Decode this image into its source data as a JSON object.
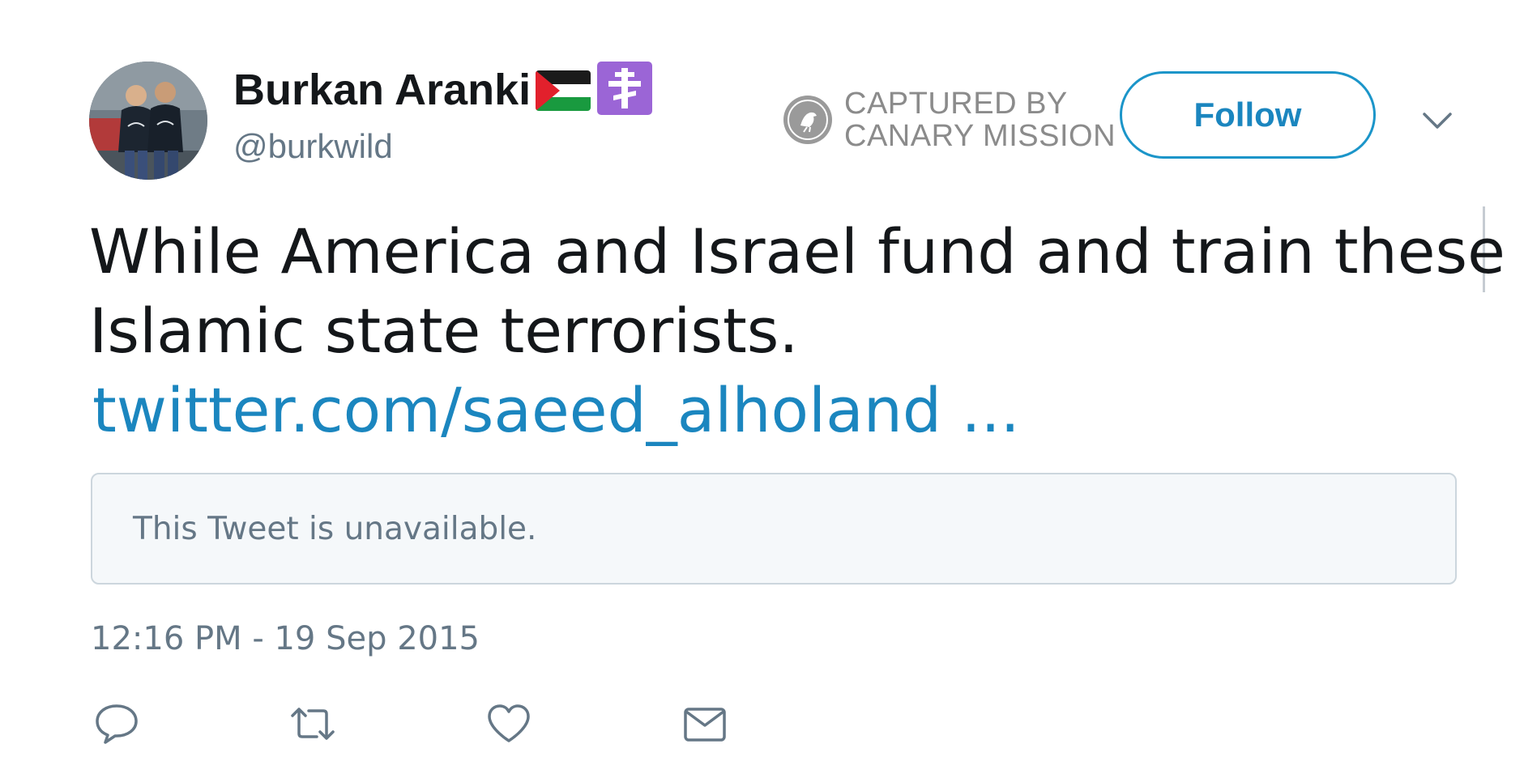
{
  "author": {
    "display_name": "Burkan Aranki",
    "handle": "@burkwild",
    "name_emojis": [
      "palestine-flag-emoji",
      "orthodox-cross-emoji"
    ]
  },
  "watermark": {
    "line1": "CAPTURED BY",
    "line2": "CANARY MISSION",
    "icon": "canary-bird-icon"
  },
  "header": {
    "follow_label": "Follow",
    "menu_icon": "chevron-down-icon"
  },
  "tweet": {
    "text_line1": "While America and Israel fund and train these",
    "text_line2": "Islamic state terrorists.",
    "link_text": "twitter.com/saeed_alholand ...",
    "quoted_status": "This Tweet is unavailable.",
    "timestamp": "12:16 PM - 19 Sep 2015"
  },
  "actions": [
    "reply-icon",
    "retweet-icon",
    "like-icon",
    "direct-message-icon"
  ],
  "colors": {
    "link_blue": "#1b86bf",
    "text": "#14171a",
    "secondary": "#657786",
    "cross_badge": "#9b65d6",
    "watermark_gray": "#8b8b8b"
  }
}
